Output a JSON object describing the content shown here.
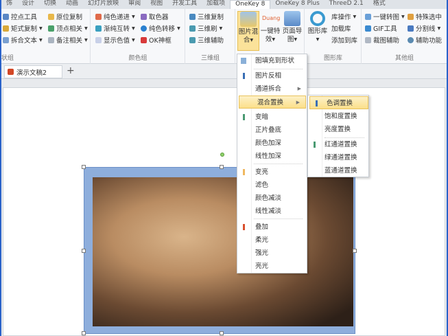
{
  "tabs": [
    "饰",
    "设计",
    "切换",
    "动画",
    "幻灯片放映",
    "审阅",
    "视图",
    "开发工具",
    "加载项",
    "OneKey 8",
    "OneKey 8 Plus",
    "ThreeD 2.1",
    "格式"
  ],
  "active_tab": "OneKey 8",
  "ribbon": {
    "g1": {
      "label": "状组",
      "items": [
        "控点工具",
        "矩式复制",
        "拆合文本",
        "原位复制",
        "顶点相关",
        "备注相关"
      ]
    },
    "g2": {
      "label": "颜色组",
      "items": [
        "纯色递进",
        "渐纯互转",
        "显示色值",
        "取色器",
        "纯色转移",
        "OK神框"
      ]
    },
    "g3": {
      "label": "三维组",
      "items": [
        "三维复制",
        "三维刷",
        "三维辅助"
      ]
    },
    "g4": {
      "big": [
        "图片混合",
        "一键特效",
        "页面导图"
      ],
      "duang": "Duang"
    },
    "g5": {
      "label": "图形库",
      "big": "图形库",
      "items": [
        "库操作",
        "加载库",
        "添加到库"
      ]
    },
    "g6": {
      "label": "其他组",
      "items": [
        "一键转图",
        "GIF工具",
        "裁图辅助",
        "特殊选中",
        "分割线",
        "辅助功能"
      ]
    }
  },
  "doc_tab": "演示文稿2",
  "menu": [
    "图填充到形状",
    "图片反相",
    "通道拆合",
    "混合置换",
    "变暗",
    "正片叠底",
    "颜色加深",
    "线性加深",
    "变亮",
    "滤色",
    "颜色减淡",
    "线性减淡",
    "叠加",
    "柔光",
    "强光",
    "亮光"
  ],
  "submenu": [
    "色调置换",
    "饱和度置换",
    "亮度置换",
    "红通道置换",
    "绿通道置换",
    "蓝通道置换"
  ],
  "colors": {
    "accent": "#fbdf8a",
    "blue_marker": "#3a6fb5",
    "green_marker": "#4a9a72",
    "orange_marker": "#f0b860",
    "red_marker": "#d9502e"
  }
}
